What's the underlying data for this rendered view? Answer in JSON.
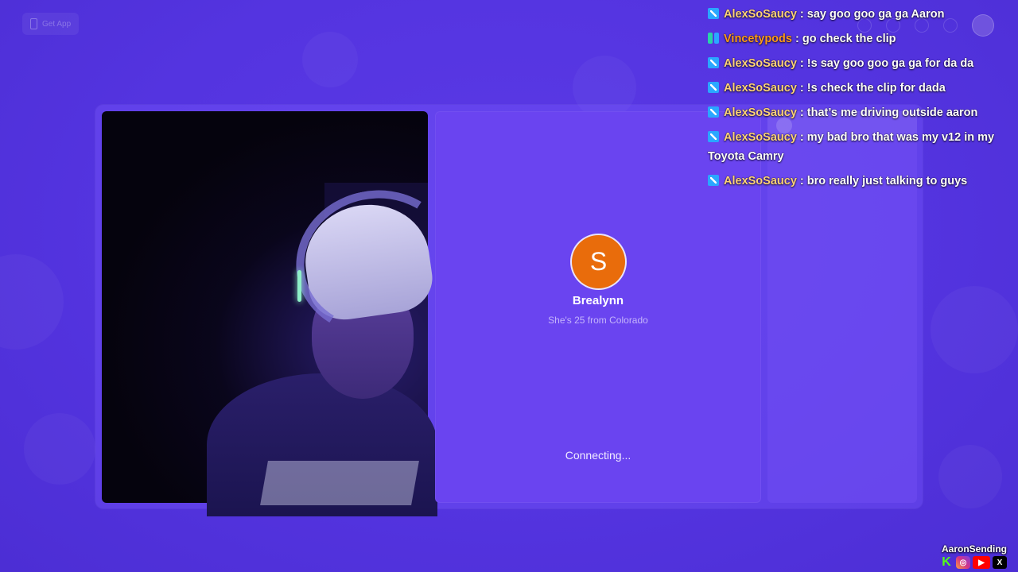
{
  "topbar": {
    "get_app_label": "Get App"
  },
  "match": {
    "avatar_initial": "S",
    "avatar_color": "#e96c0b",
    "name": "Brealynn",
    "bio": "She's 25 from Colorado",
    "status": "Connecting..."
  },
  "chat": {
    "messages": [
      {
        "user": "AlexSoSaucy",
        "user_color": "#ffd37a",
        "badge": "blue",
        "text": " : say goo goo ga ga Aaron"
      },
      {
        "user": "Vincetypods",
        "user_color": "#ff9a1f",
        "badge": "green",
        "text": " : go check the clip"
      },
      {
        "user": "AlexSoSaucy",
        "user_color": "#ffd37a",
        "badge": "blue",
        "text": " : !s say goo goo ga ga for da da"
      },
      {
        "user": "AlexSoSaucy",
        "user_color": "#ffd37a",
        "badge": "blue",
        "text": " : !s check the clip for dada"
      },
      {
        "user": "AlexSoSaucy",
        "user_color": "#ffd37a",
        "badge": "blue",
        "text": " : that’s me driving outside aaron"
      },
      {
        "user": "AlexSoSaucy",
        "user_color": "#ffd37a",
        "badge": "blue",
        "text": " : my bad bro that was my v12 in my Toyota Camry"
      },
      {
        "user": "AlexSoSaucy",
        "user_color": "#ffd37a",
        "badge": "blue",
        "text": " : bro really just talking to guys"
      }
    ]
  },
  "watermark": {
    "name": "AaronSending",
    "icons": [
      "kick-icon",
      "instagram-icon",
      "youtube-icon",
      "x-icon"
    ]
  }
}
